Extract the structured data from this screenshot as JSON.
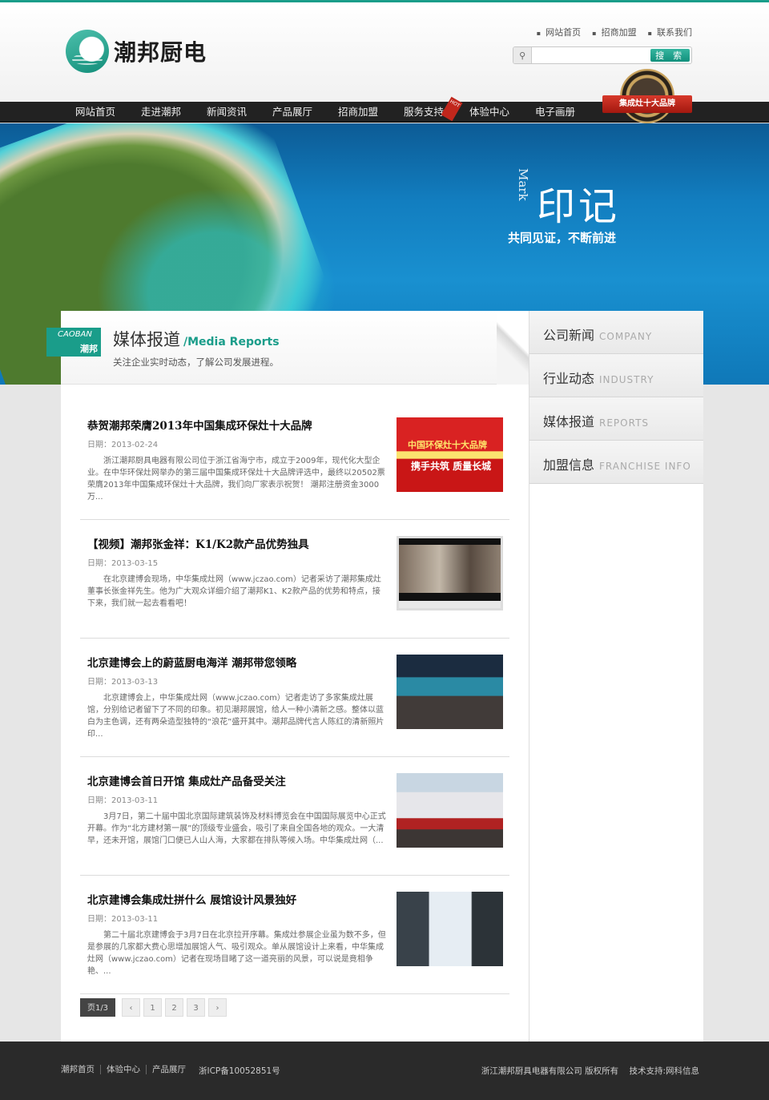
{
  "brand": {
    "name": "潮邦厨电",
    "tag_en": "CAOBAN",
    "tag_cn": "潮邦"
  },
  "toplinks": [
    "网站首页",
    "招商加盟",
    "联系我们"
  ],
  "search": {
    "placeholder": "",
    "button": "搜 索"
  },
  "nav": [
    "网站首页",
    "走进潮邦",
    "新闻资讯",
    "产品展厅",
    "招商加盟",
    "服务支持",
    "体验中心",
    "电子画册"
  ],
  "hot_label": "HOT",
  "badge": {
    "ribbon": "集成灶十大品牌"
  },
  "banner": {
    "mark_en": "Mark",
    "title": "印记",
    "subtitle": "共同见证，不断前进"
  },
  "section": {
    "title": "媒体报道",
    "title_en": "/Media Reports",
    "desc": "关注企业实时动态，了解公司发展进程。"
  },
  "news": [
    {
      "title": "恭贺潮邦荣膺2013年中国集成环保灶十大品牌",
      "date": "日期：2013-02-24",
      "summary": "浙江潮邦厨具电器有限公司位于浙江省海宁市，成立于2009年，现代化大型企业。在中华环保灶网举办的第三届中国集成环保灶十大品牌评选中，最终以20502票荣膺2013年中国集成环保灶十大品牌，我们向厂家表示祝贺！ 潮邦注册资金3000万..."
    },
    {
      "title": "【视频】潮邦张金祥：K1/K2款产品优势独具",
      "date": "日期：2013-03-15",
      "summary": "在北京建博会现场，中华集成灶网（www.jczao.com）记者采访了潮邦集成灶董事长张金祥先生。他为广大观众详细介绍了潮邦K1、K2款产品的优势和特点，接下来，我们就一起去看看吧！"
    },
    {
      "title": "北京建博会上的蔚蓝厨电海洋 潮邦带您领略",
      "date": "日期：2013-03-13",
      "summary": "北京建博会上，中华集成灶网（www.jczao.com）记者走访了多家集成灶展馆，分别给记者留下了不同的印象。初见潮邦展馆，给人一种小清新之感。整体以蓝白为主色调，还有两朵造型独特的“浪花”盛开其中。潮邦品牌代言人陈红的清新照片印..."
    },
    {
      "title": "北京建博会首日开馆 集成灶产品备受关注",
      "date": "日期：2013-03-11",
      "summary": "3月7日，第二十届中国北京国际建筑装饰及材料博览会在中国国际展览中心正式开幕。作为“北方建材第一展”的顶级专业盛会，吸引了来自全国各地的观众。一大清早，还未开馆，展馆门口便已人山人海，大家都在排队等候入场。中华集成灶网（..."
    },
    {
      "title": "北京建博会集成灶拼什么 展馆设计风景独好",
      "date": "日期：2013-03-11",
      "summary": "第二十届北京建博会于3月7日在北京拉开序幕。集成灶参展企业虽为数不多，但是参展的几家都大费心思增加展馆人气、吸引观众。单从展馆设计上来看，中华集成灶网（www.jczao.com）记者在现场目睹了这一道亮丽的风景，可以说是竟相争艳、..."
    }
  ],
  "img1_text": {
    "line1": "中国环保灶十大品牌",
    "line2": "携手共筑 质量长城"
  },
  "pager": {
    "info": "页1/3",
    "prev": "‹",
    "pages": [
      "1",
      "2",
      "3"
    ],
    "next": "›"
  },
  "sidebar": [
    {
      "cn": "公司新闻",
      "en": "COMPANY"
    },
    {
      "cn": "行业动态",
      "en": "INDUSTRY"
    },
    {
      "cn": "媒体报道",
      "en": "REPORTS"
    },
    {
      "cn": "加盟信息",
      "en": "FRANCHISE INFO"
    }
  ],
  "footer": {
    "links": [
      "潮邦首页",
      "体验中心",
      "产品展厅"
    ],
    "icp": "浙ICP备10052851号",
    "copyright": "浙江潮邦厨具电器有限公司 版权所有",
    "tech": "技术支持:网科信息"
  },
  "colors": {
    "accent": "#1a9d8a",
    "nav_bg": "#222222",
    "footer_bg": "#2a2a2a"
  }
}
